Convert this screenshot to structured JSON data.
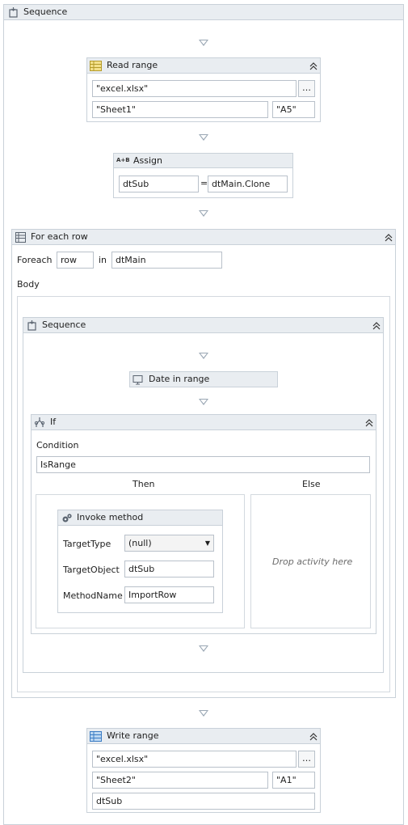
{
  "outer": {
    "title": "Sequence",
    "icon": "sequence-icon"
  },
  "read_range": {
    "title": "Read range",
    "file": "\"excel.xlsx\"",
    "browse": "…",
    "sheet": "\"Sheet1\"",
    "range": "\"A5\""
  },
  "assign": {
    "title": "Assign",
    "prefix": "A+B",
    "to": "dtSub",
    "equals": "=",
    "value": "dtMain.Clone"
  },
  "foreach": {
    "title": "For each row",
    "foreach_label": "Foreach",
    "item": "row",
    "in_label": "in",
    "collection": "dtMain",
    "body_label": "Body"
  },
  "inner_sequence": {
    "title": "Sequence"
  },
  "date_in_range": {
    "title": "Date in range"
  },
  "if_block": {
    "title": "If",
    "condition_label": "Condition",
    "condition": "IsRange",
    "then_label": "Then",
    "else_label": "Else",
    "else_placeholder": "Drop activity here"
  },
  "invoke": {
    "title": "Invoke method",
    "target_type_label": "TargetType",
    "target_type": "(null)",
    "target_object_label": "TargetObject",
    "target_object": "dtSub",
    "method_name_label": "MethodName",
    "method_name": "ImportRow"
  },
  "write_range": {
    "title": "Write range",
    "file": "\"excel.xlsx\"",
    "browse": "…",
    "sheet": "\"Sheet2\"",
    "range": "\"A1\"",
    "data": "dtSub"
  }
}
